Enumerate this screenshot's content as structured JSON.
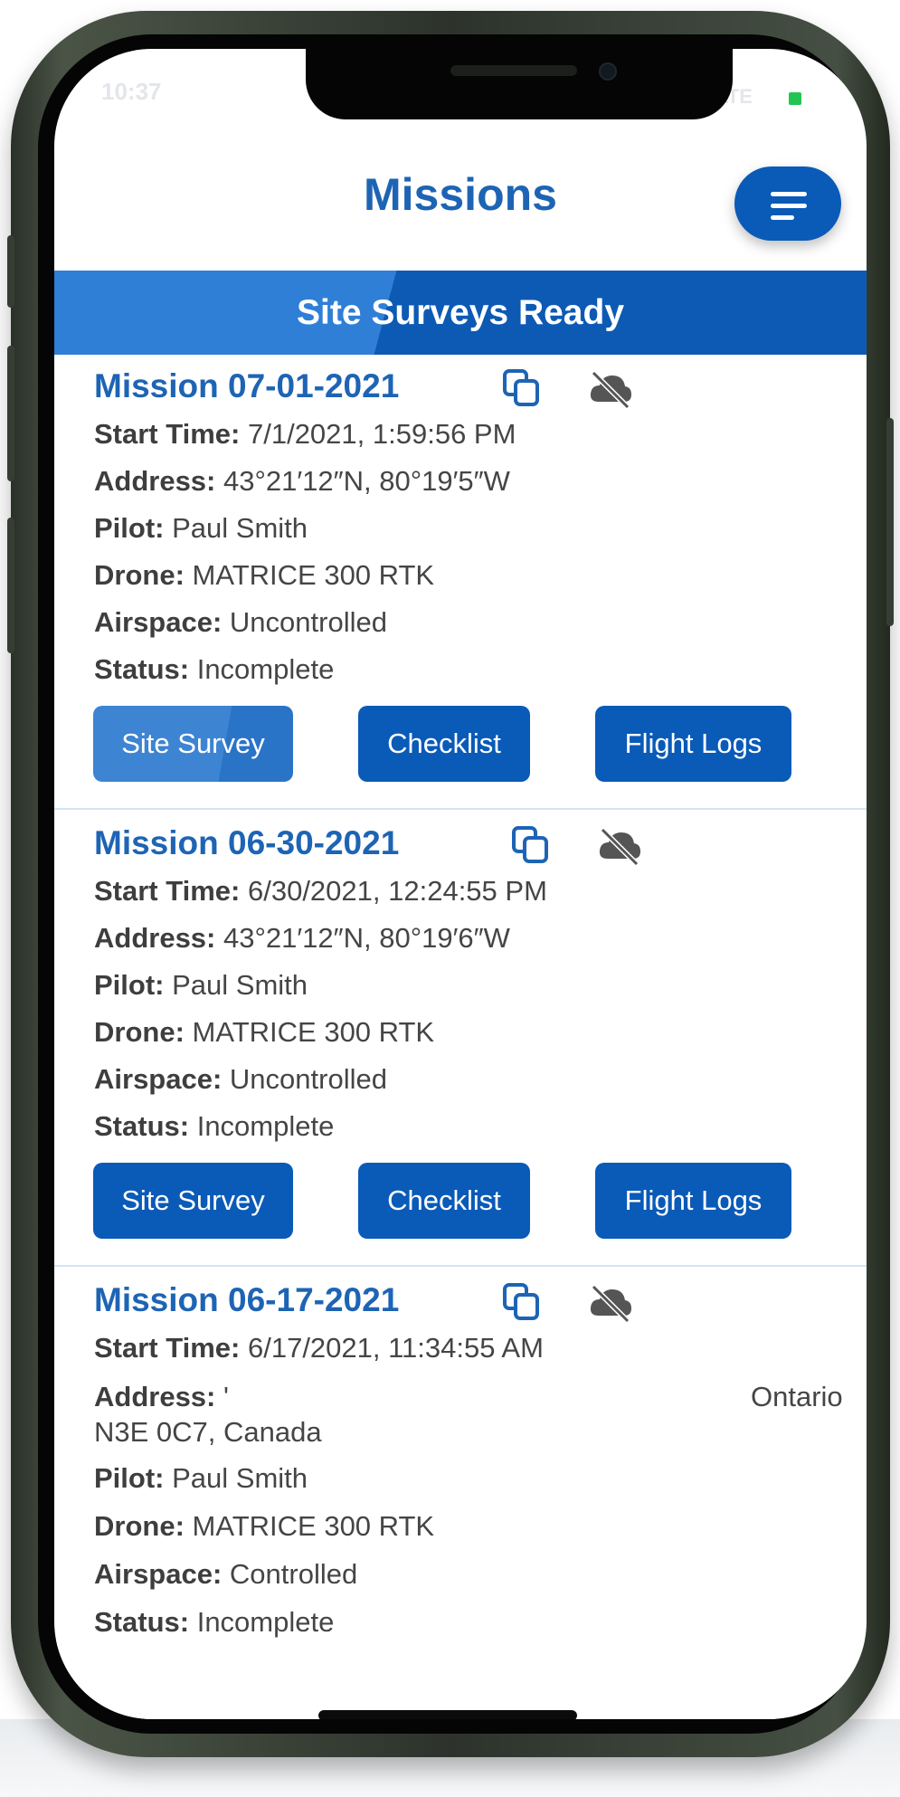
{
  "status_bar": {
    "time": "10:37",
    "signal": "LTE"
  },
  "header": {
    "title": "Missions",
    "menu_icon": "menu-lines-icon"
  },
  "banner": {
    "label": "Site Surveys Ready"
  },
  "missions": [
    {
      "name": "Mission 07-01-2021",
      "start_time_label": "Start Time:",
      "start_time": "7/1/2021, 1:59:56 PM",
      "address_label": "Address:",
      "address": "43°21′12″N, 80°19′5″W",
      "pilot_label": "Pilot:",
      "pilot": "Paul Smith",
      "drone_label": "Drone:",
      "drone": "MATRICE 300 RTK",
      "airspace_label": "Airspace:",
      "airspace": "Uncontrolled",
      "status_label": "Status:",
      "status": "Incomplete",
      "buttons": {
        "survey": "Site Survey",
        "checklist": "Checklist",
        "logs": "Flight Logs"
      }
    },
    {
      "name": "Mission 06-30-2021",
      "start_time_label": "Start Time:",
      "start_time": "6/30/2021, 12:24:55 PM",
      "address_label": "Address:",
      "address": "43°21′12″N, 80°19′6″W",
      "pilot_label": "Pilot:",
      "pilot": "Paul Smith",
      "drone_label": "Drone:",
      "drone": "MATRICE 300 RTK",
      "airspace_label": "Airspace:",
      "airspace": "Uncontrolled",
      "status_label": "Status:",
      "status": "Incomplete",
      "buttons": {
        "survey": "Site Survey",
        "checklist": "Checklist",
        "logs": "Flight Logs"
      }
    },
    {
      "name": "Mission 06-17-2021",
      "start_time_label": "Start Time:",
      "start_time": "6/17/2021, 11:34:55 AM",
      "address_label": "Address:",
      "address": "'",
      "address_tail": "Ontario",
      "address_line2": "N3E 0C7, Canada",
      "pilot_label": "Pilot:",
      "pilot": "Paul Smith",
      "drone_label": "Drone:",
      "drone": "MATRICE 300 RTK",
      "airspace_label": "Airspace:",
      "airspace": "Controlled",
      "status_label": "Status:",
      "status": "Incomplete"
    }
  ],
  "colors": {
    "brand_blue": "#0a5ab8",
    "title_blue": "#1e64b4",
    "accent_light": "#2f7fd6"
  }
}
